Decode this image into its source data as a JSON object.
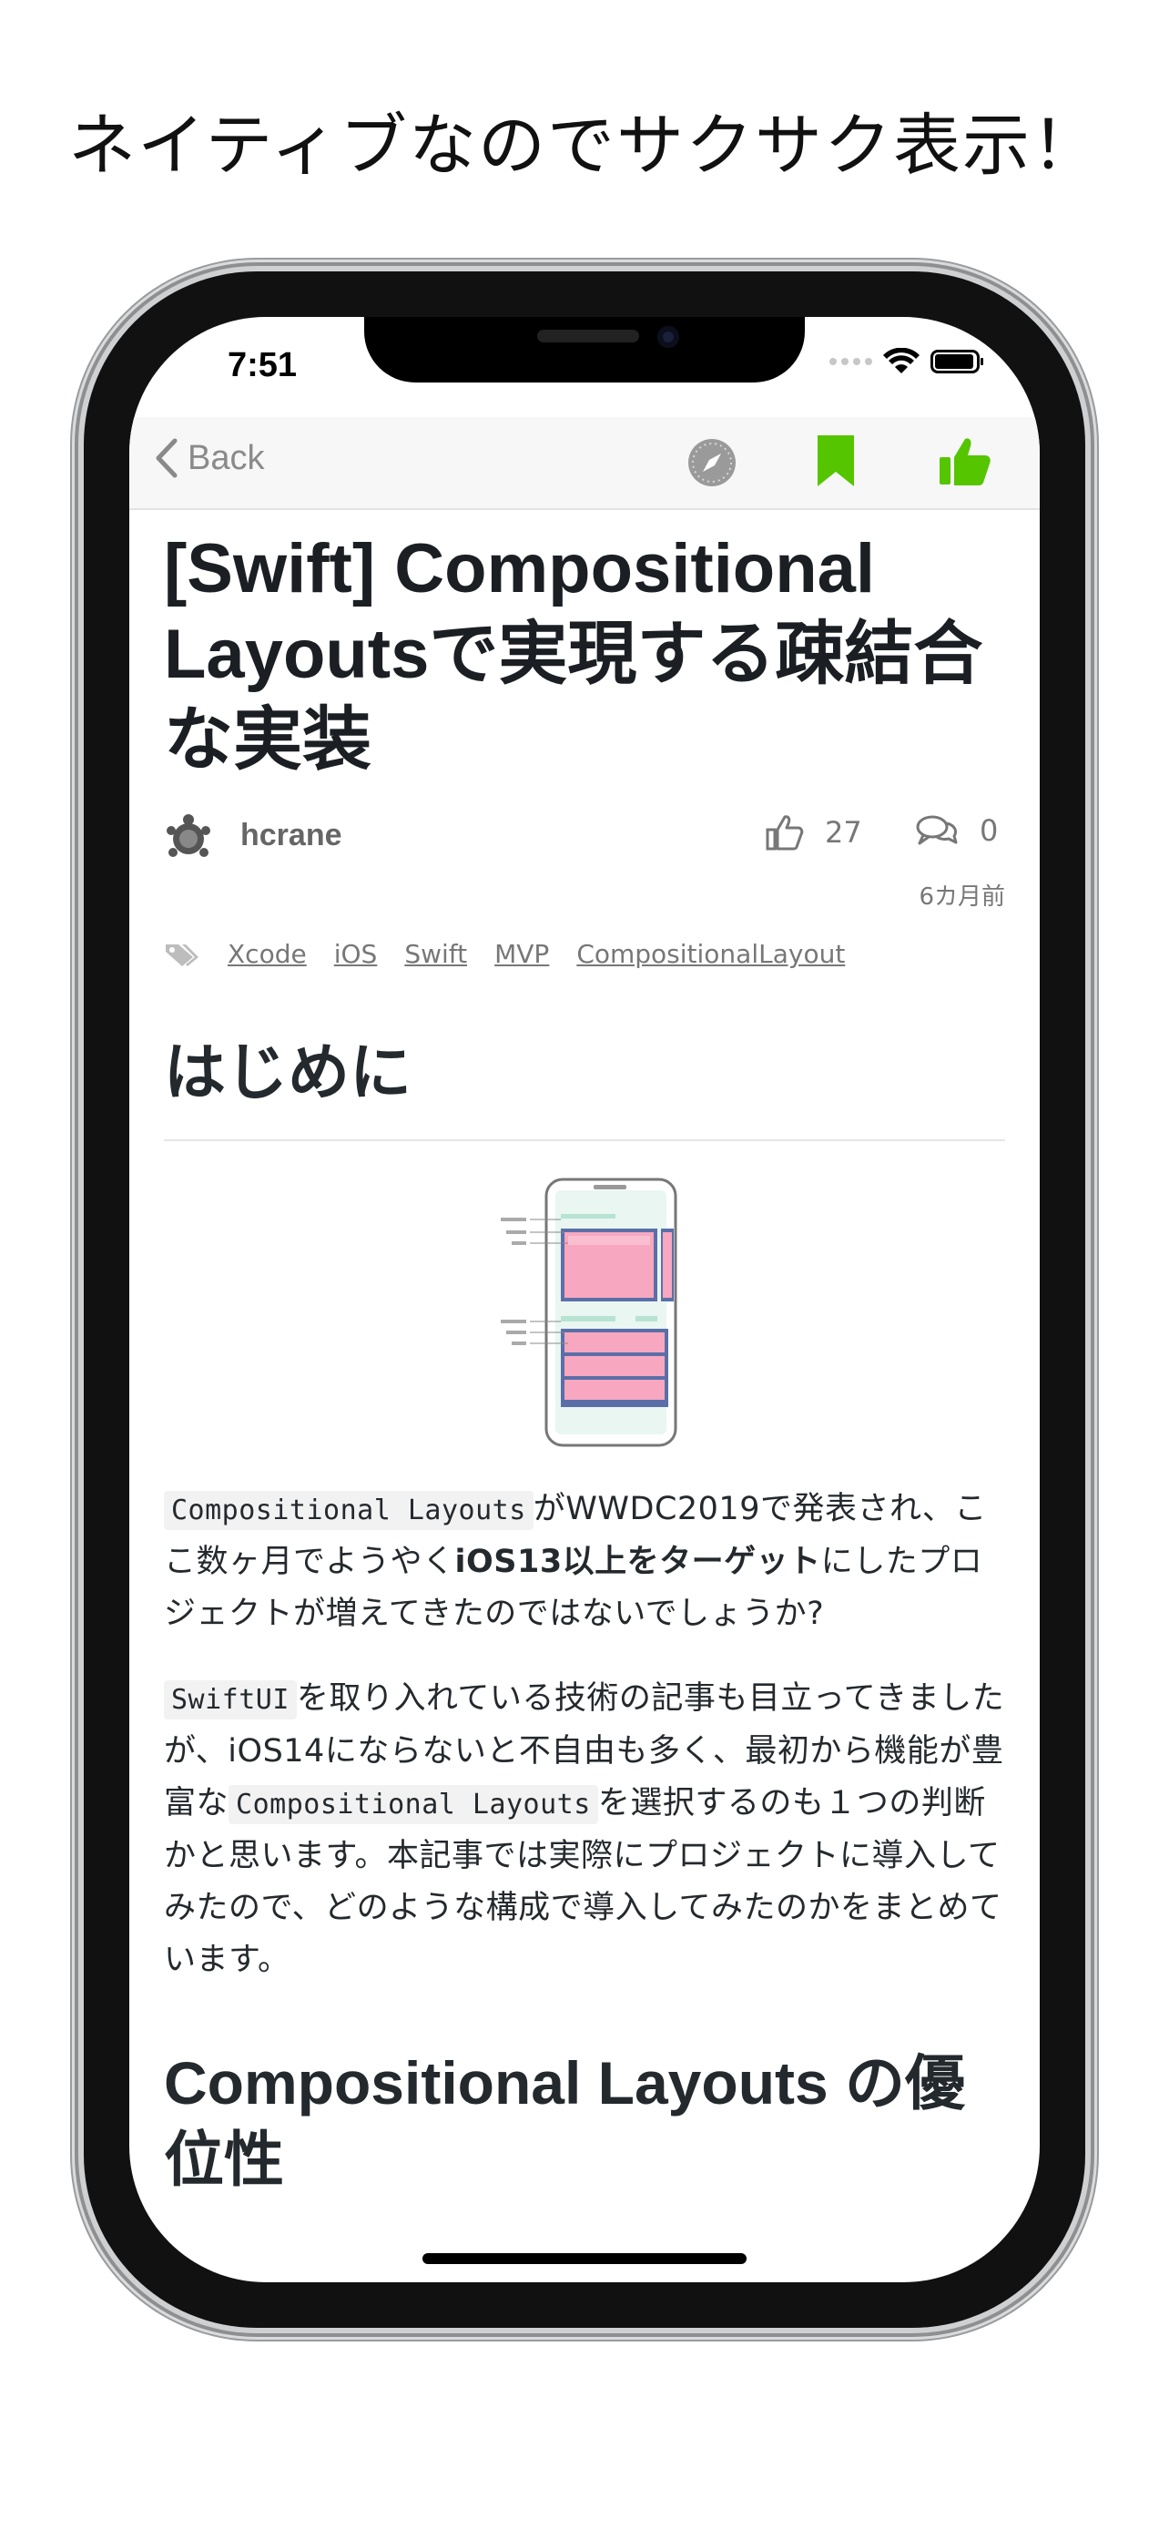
{
  "headline": "ネイティブなのでサクサク表示！",
  "status_bar": {
    "time": "7:51"
  },
  "nav": {
    "back_label": "Back",
    "icons": [
      "safari-compass-icon",
      "bookmark-icon",
      "thumbs-up-icon"
    ],
    "accent_color": "#55c500"
  },
  "article": {
    "title": "[Swift] Compositional Layoutsで実現する疎結合な実装",
    "author": "hcrane",
    "likes": "27",
    "comments": "0",
    "posted": "6カ月前",
    "tags": [
      "Xcode",
      "iOS",
      "Swift",
      "MVP",
      "CompositionalLayout"
    ],
    "section1_heading": "はじめに",
    "para1": {
      "code1": "Compositional Layouts",
      "text1": "がWWDC2019で発表され、ここ数ヶ月でようやく",
      "bold": "iOS13以上をターゲット",
      "text2": "にしたプロジェクトが増えてきたのではないでしょうか?"
    },
    "para2": {
      "code1": "SwiftUI",
      "text1": "を取り入れている技術の記事も目立ってきましたが、iOS14にならないと不自由も多く、最初から機能が豊富な",
      "code2": "Compositional Layouts",
      "text2": "を選択するのも１つの判断かと思います。本記事では実際にプロジェクトに導入してみたので、どのような構成で導入してみたのかをまとめています。"
    },
    "section2_heading": "Compositional Layouts の優位性"
  }
}
